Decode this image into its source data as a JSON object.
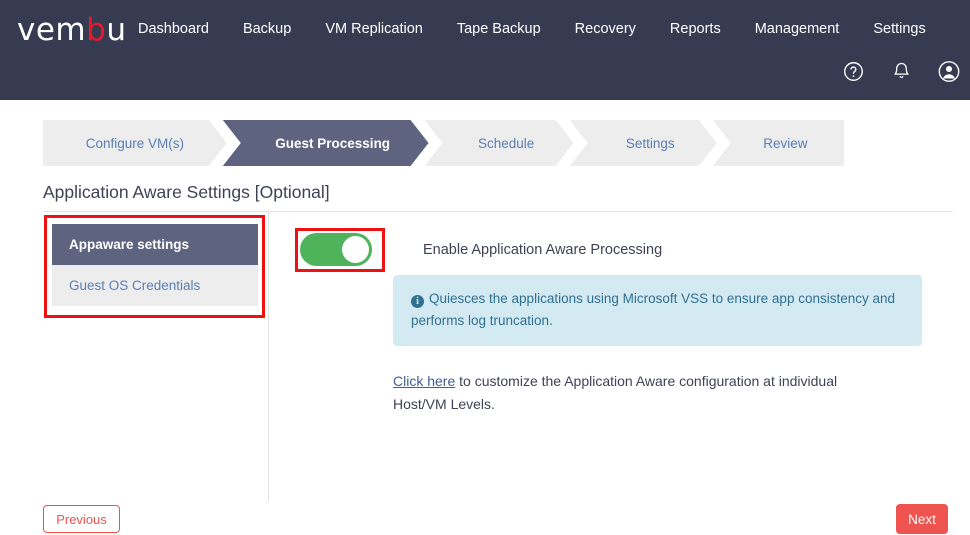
{
  "header": {
    "logo_text_1": "vem",
    "logo_text_accent": "b",
    "logo_text_2": "u",
    "nav": [
      {
        "label": "Dashboard"
      },
      {
        "label": "Backup"
      },
      {
        "label": "VM Replication"
      },
      {
        "label": "Tape Backup"
      },
      {
        "label": "Recovery"
      },
      {
        "label": "Reports"
      },
      {
        "label": "Management"
      },
      {
        "label": "Settings"
      }
    ],
    "icons": [
      {
        "name": "help-icon"
      },
      {
        "name": "notification-bell-icon"
      },
      {
        "name": "user-account-icon"
      }
    ],
    "background_color": "#373b52",
    "accent_color": "#e8192c"
  },
  "wizard": {
    "steps": [
      {
        "label": "Configure VM(s)",
        "active": false
      },
      {
        "label": "Guest Processing",
        "active": true
      },
      {
        "label": "Schedule",
        "active": false
      },
      {
        "label": "Settings",
        "active": false
      },
      {
        "label": "Review",
        "active": false
      }
    ],
    "active_color": "#5e6480",
    "inactive_color": "#ededed",
    "inactive_text_color": "#5b7fb3"
  },
  "page": {
    "title": "Application Aware Settings [Optional]"
  },
  "subnav": {
    "items": [
      {
        "label": "Appaware settings",
        "active": true
      },
      {
        "label": "Guest OS Credentials",
        "active": false
      }
    ]
  },
  "toggle": {
    "label": "Enable Application Aware Processing",
    "state": "on",
    "on_color": "#4eb35a"
  },
  "info": {
    "text": "Quiesces the applications using Microsoft VSS to ensure app consistency and performs log truncation.",
    "icon": "info-circle-icon",
    "background_color": "#d3eaf3",
    "text_color": "#31708f"
  },
  "help": {
    "link_label": "Click here",
    "rest_text": " to customize the Application Aware configuration at individual Host/VM Levels."
  },
  "footer": {
    "previous_label": "Previous",
    "next_label": "Next",
    "button_color": "#ef5350"
  },
  "annotations": {
    "color": "#ee1111",
    "boxes": [
      {
        "name": "subnav-highlight"
      },
      {
        "name": "toggle-highlight"
      }
    ]
  }
}
